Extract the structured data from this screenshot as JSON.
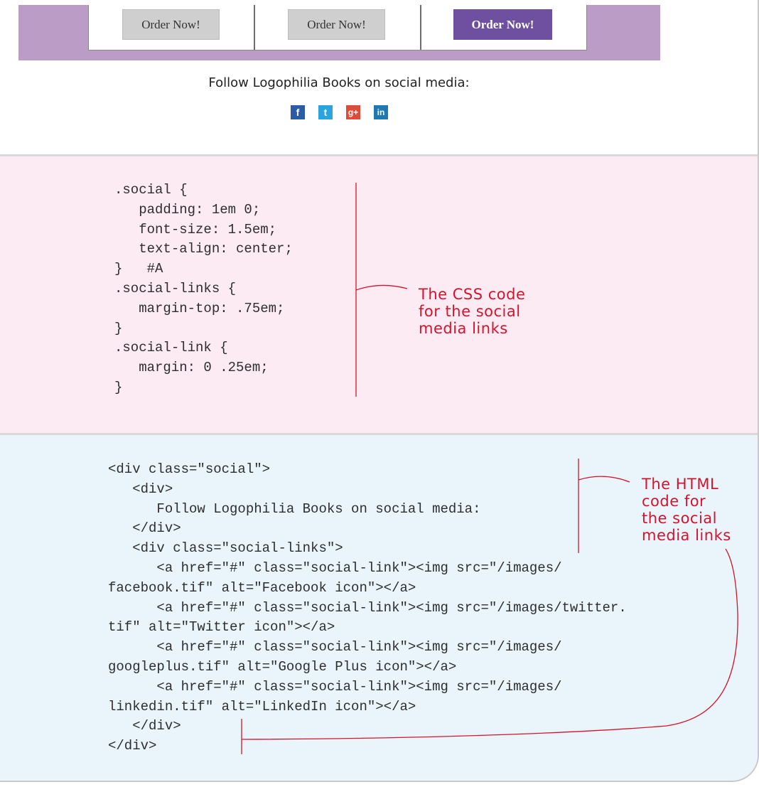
{
  "preview": {
    "buttons": [
      "Order Now!",
      "Order Now!",
      "Order Now!"
    ],
    "follow_text": "Follow Logophilia Books on social media:",
    "social_icons": [
      {
        "name": "facebook-icon",
        "glyph": "f",
        "color": "#2a5ca8"
      },
      {
        "name": "twitter-icon",
        "glyph": "t",
        "color": "#29a4e0"
      },
      {
        "name": "googleplus-icon",
        "glyph": "g+",
        "color": "#dd4b39"
      },
      {
        "name": "linkedin-icon",
        "glyph": "in",
        "color": "#1e78b4"
      }
    ],
    "colors": {
      "band": "#bb9cc7",
      "primary_button": "#6e4fa0"
    }
  },
  "css_section": {
    "code": ".social {\n   padding: 1em 0;\n   font-size: 1.5em;\n   text-align: center;\n}   #A\n.social-links {\n   margin-top: .75em;\n}\n.social-link {\n   margin: 0 .25em;\n}",
    "annotation": "The CSS code\nfor the social\nmedia links"
  },
  "html_section": {
    "code": "<div class=\"social\">\n   <div>\n      Follow Logophilia Books on social media:\n   </div>\n   <div class=\"social-links\">\n      <a href=\"#\" class=\"social-link\"><img src=\"/images/\nfacebook.tif\" alt=\"Facebook icon\"></a>\n      <a href=\"#\" class=\"social-link\"><img src=\"/images/twitter.\ntif\" alt=\"Twitter icon\"></a>\n      <a href=\"#\" class=\"social-link\"><img src=\"/images/\ngoogleplus.tif\" alt=\"Google Plus icon\"></a>\n      <a href=\"#\" class=\"social-link\"><img src=\"/images/\nlinkedin.tif\" alt=\"LinkedIn icon\"></a>\n   </div>\n</div>",
    "annotation": "The HTML\ncode for\nthe social\nmedia links"
  }
}
